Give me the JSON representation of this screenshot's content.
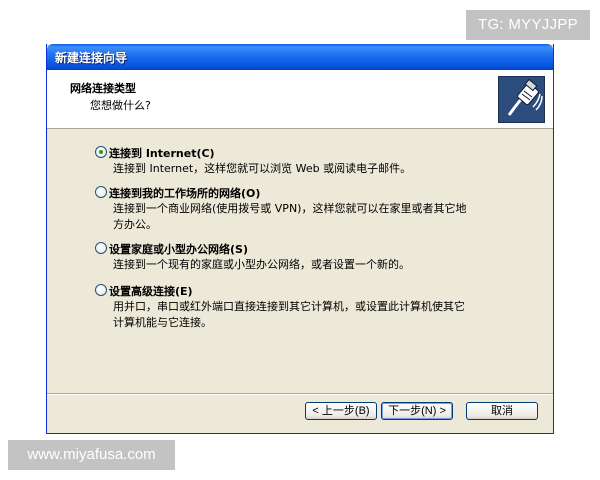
{
  "watermarks": {
    "top": "TG: MYYJJPP",
    "bottom": "www.miyafusa.com"
  },
  "window": {
    "title": "新建连接向导"
  },
  "header": {
    "title": "网络连接类型",
    "subtitle": "您想做什么?",
    "icon": "network-cable-icon"
  },
  "options": [
    {
      "label": "连接到 Internet(C)",
      "description": [
        "连接到 Internet，这样您就可以浏览 Web 或阅读电子邮件。"
      ],
      "selected": true
    },
    {
      "label": "连接到我的工作场所的网络(O)",
      "description": [
        "连接到一个商业网络(使用拨号或 VPN)，这样您就可以在家里或者其它地",
        "方办公。"
      ],
      "selected": false
    },
    {
      "label": "设置家庭或小型办公网络(S)",
      "description": [
        "连接到一个现有的家庭或小型办公网络，或者设置一个新的。"
      ],
      "selected": false
    },
    {
      "label": "设置高级连接(E)",
      "description": [
        "用并口，串口或红外端口直接连接到其它计算机，或设置此计算机使其它",
        "计算机能与它连接。"
      ],
      "selected": false
    }
  ],
  "buttons": {
    "back": "< 上一步(B)",
    "next": "下一步(N) >",
    "cancel": "取消"
  },
  "colors": {
    "titlebar": "#0654de",
    "dialog_bg": "#ece9d8",
    "radio_dot": "#21a121"
  }
}
